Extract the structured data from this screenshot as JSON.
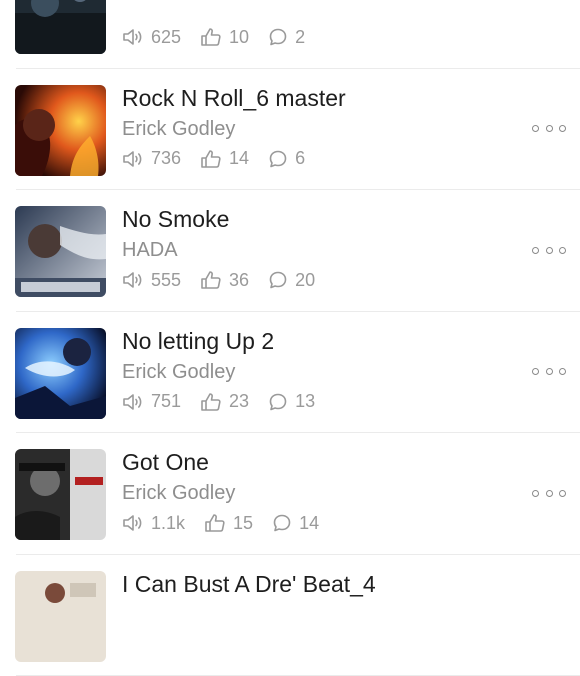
{
  "tracks": [
    {
      "title": "",
      "artist": "",
      "plays": "625",
      "likes": "10",
      "comments": "2"
    },
    {
      "title": "Rock N Roll_6 master",
      "artist": "Erick Godley",
      "plays": "736",
      "likes": "14",
      "comments": "6"
    },
    {
      "title": "No Smoke",
      "artist": "HADA",
      "plays": "555",
      "likes": "36",
      "comments": "20"
    },
    {
      "title": "No letting Up 2",
      "artist": "Erick Godley",
      "plays": "751",
      "likes": "23",
      "comments": "13"
    },
    {
      "title": "Got One",
      "artist": "Erick Godley",
      "plays": "1.1k",
      "likes": "15",
      "comments": "14"
    },
    {
      "title": "I Can Bust A Dre' Beat_4",
      "artist": "",
      "plays": "",
      "likes": "",
      "comments": ""
    }
  ],
  "icons": {
    "plays": "speaker-icon",
    "likes": "thumbs-up-icon",
    "comments": "comment-bubble-icon",
    "more": "more-options-icon"
  },
  "colors": {
    "title": "#1e1e1e",
    "secondary": "#8e8e8e",
    "divider": "#ebebeb"
  }
}
